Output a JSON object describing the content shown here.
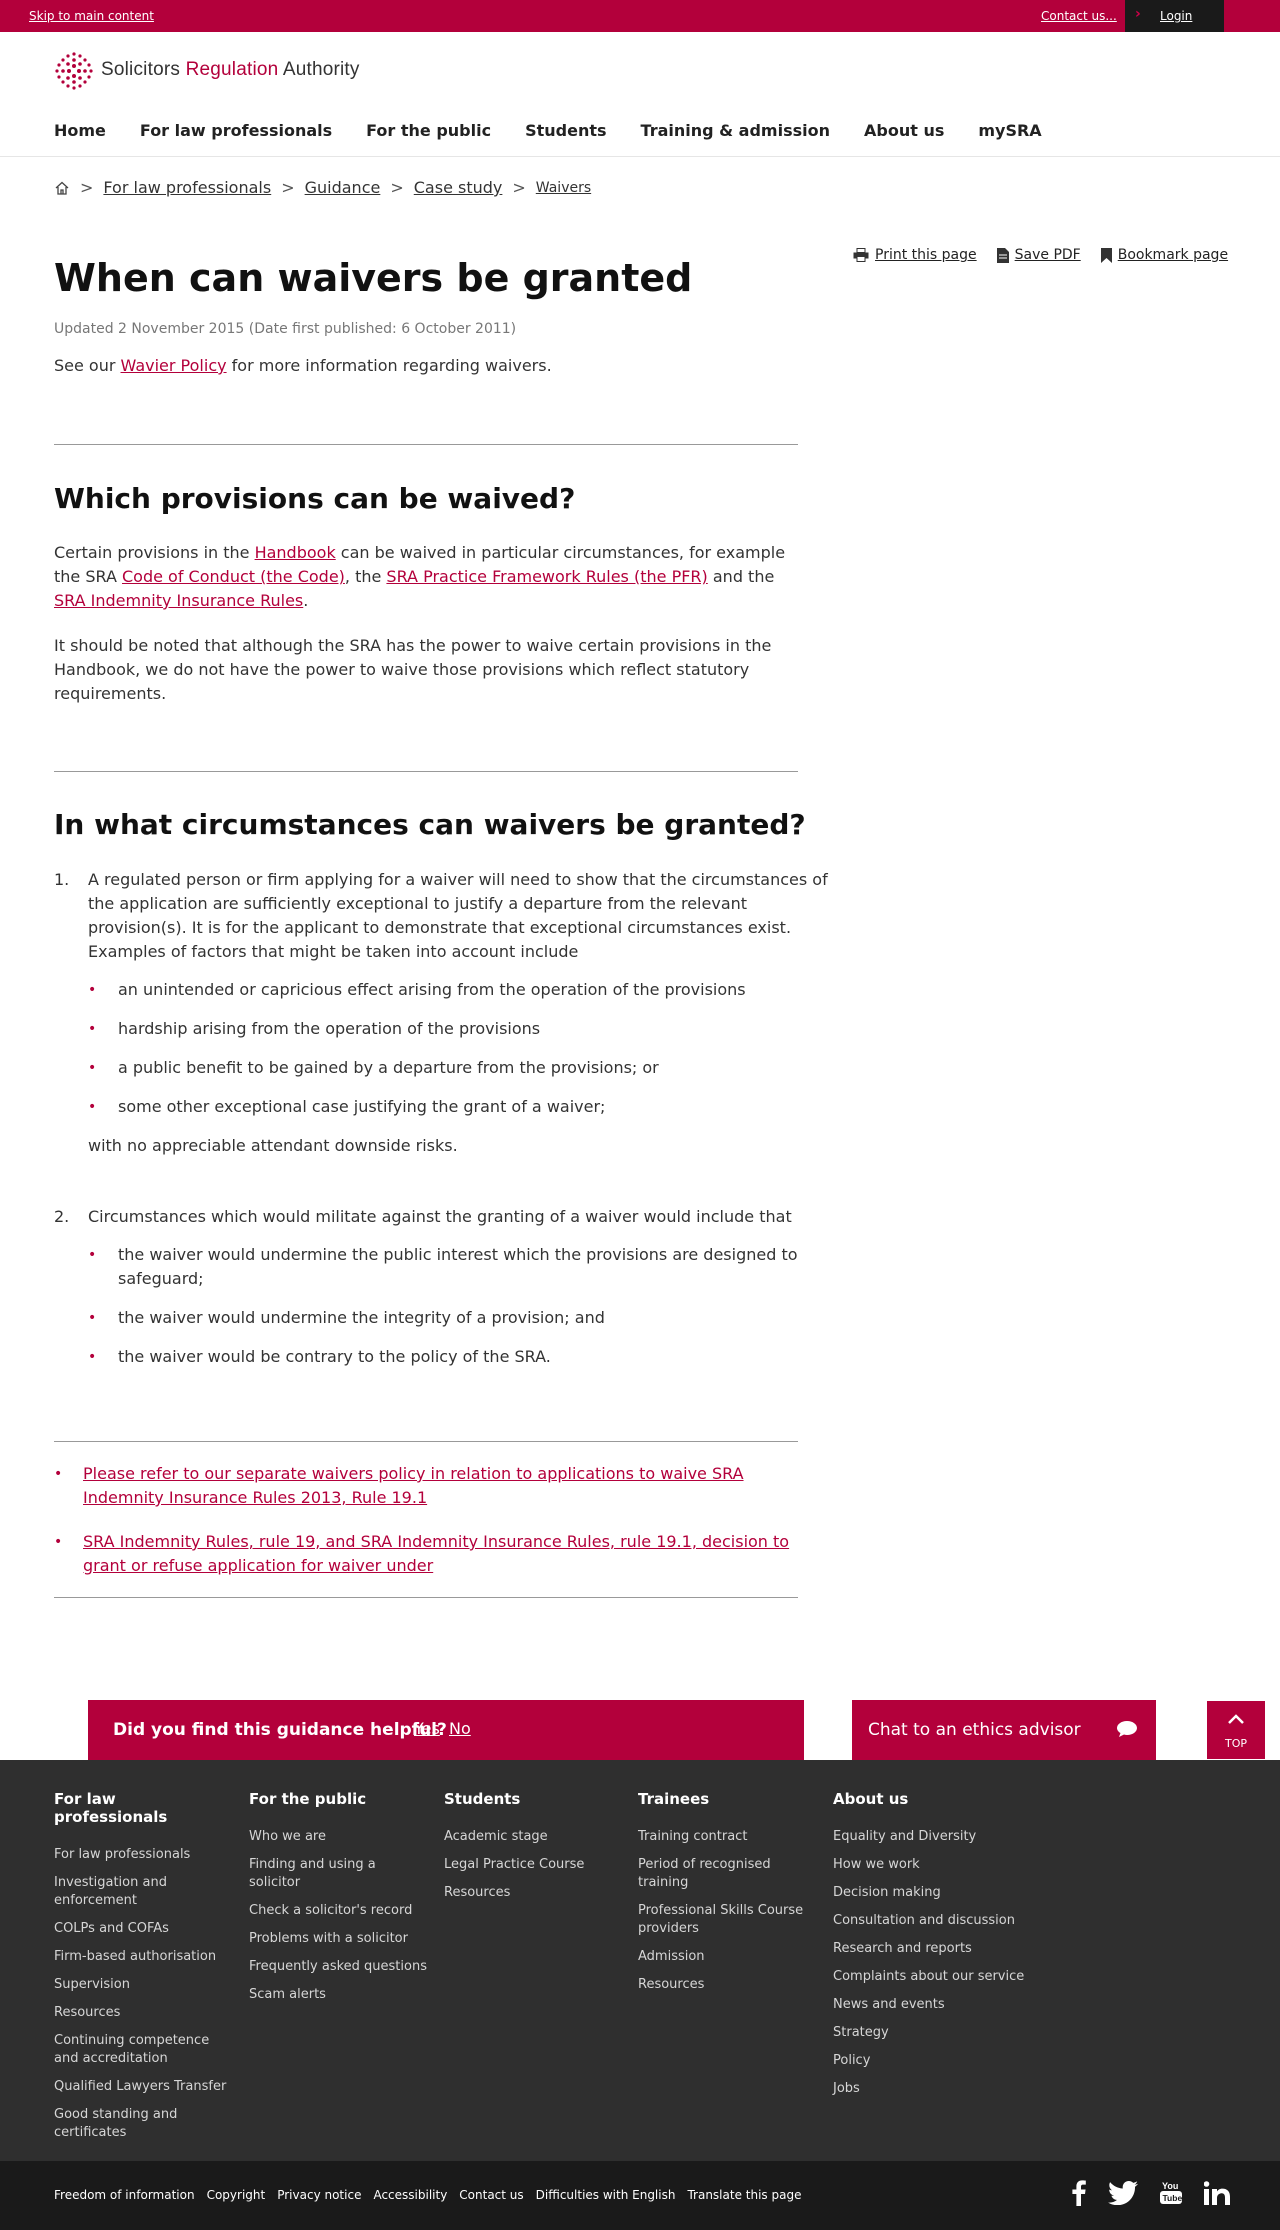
{
  "topbar": {
    "skip": "Skip to main content",
    "contact": "Contact us...",
    "login": "Login"
  },
  "logo": {
    "part1": "Solicitors ",
    "part2": "Regulation",
    "part3": " Authority"
  },
  "nav": [
    "Home",
    "For law professionals",
    "For the public",
    "Students",
    "Training & admission",
    "About us",
    "mySRA"
  ],
  "breadcrumb": {
    "sep": ">",
    "items": [
      "For law professionals",
      "Guidance",
      "Case study"
    ],
    "current": "Waivers"
  },
  "tools": {
    "print": "Print this page",
    "pdf": "Save PDF",
    "bookmark": "Bookmark page"
  },
  "page": {
    "title": "When can waivers be granted",
    "updated": "Updated 2 November 2015 (Date first published: 6 October 2011)",
    "intro_pre": "See our ",
    "intro_link": "Wavier Policy",
    "intro_post": " for more information regarding waivers."
  },
  "section1": {
    "heading": "Which provisions can be waived?",
    "p1_a": "Certain provisions in the ",
    "p1_link1": "Handbook",
    "p1_b": " can be waived in particular circumstances, for example the SRA ",
    "p1_link2": "Code of Conduct (the Code)",
    "p1_c": ", the ",
    "p1_link3": "SRA Practice Framework Rules (the PFR)",
    "p1_d": " and the ",
    "p1_link4": "SRA Indemnity Insurance Rules",
    "p1_e": ".",
    "p2": "It should be noted that although the SRA has the power to waive certain provisions in the Handbook, we do not have the power to waive those provisions which reflect statutory requirements."
  },
  "section2": {
    "heading": "In what circumstances can waivers be granted?",
    "item1": {
      "num": "1.",
      "text": "A regulated person or firm applying for a waiver will need to show that the circumstances of the application are sufficiently exceptional to justify a departure from the relevant provision(s). It is for the applicant to demonstrate that exceptional circumstances exist. Examples of factors that might be taken into account include",
      "bullets": [
        "an unintended or capricious effect arising from the operation of the provisions",
        "hardship arising from the operation of the provisions",
        "a public benefit to be gained by a departure from the provisions; or",
        "some other exceptional case justifying the grant of a waiver;"
      ],
      "tail": "with no appreciable attendant downside risks."
    },
    "item2": {
      "num": "2.",
      "text": "Circumstances which would militate against the granting of a waiver would include that",
      "bullets": [
        "the waiver would undermine the public interest which the provisions are designed to safeguard;",
        "the waiver would undermine the integrity of a provision; and",
        "the waiver would be contrary to the policy of the SRA."
      ]
    }
  },
  "related": [
    "Please refer to our separate waivers policy in relation to applications to waive SRA Indemnity Insurance Rules 2013, Rule 19.1",
    "SRA Indemnity Rules, rule 19, and SRA Indemnity Insurance Rules, rule 19.1, decision to grant or refuse application for waiver under"
  ],
  "feedback": {
    "question": "Did you find this guidance helpful?",
    "yes": "Yes",
    "no": "No"
  },
  "chat": {
    "label": "Chat to an ethics advisor"
  },
  "top": {
    "label": "TOP"
  },
  "footer": {
    "cols": [
      {
        "title": "For law professionals",
        "items": [
          "For law professionals",
          "Investigation and enforcement",
          "COLPs and COFAs",
          "Firm-based authorisation",
          "Supervision",
          "Resources",
          "Continuing competence and accreditation",
          "Qualified Lawyers Transfer",
          "Good standing and certificates"
        ]
      },
      {
        "title": "For the public",
        "items": [
          "Who we are",
          "Finding and using a solicitor",
          "Check a solicitor's record",
          "Problems with a solicitor",
          "Frequently asked questions",
          "Scam alerts"
        ]
      },
      {
        "title": "Students",
        "items": [
          "Academic stage",
          "Legal Practice Course",
          "Resources"
        ]
      },
      {
        "title": "Trainees",
        "items": [
          "Training contract",
          "Period of recognised training",
          "Professional Skills Course providers",
          "Admission",
          "Resources"
        ]
      },
      {
        "title": "About us",
        "items": [
          "Equality and Diversity",
          "How we work",
          "Decision making",
          "Consultation and discussion",
          "Research and reports",
          "Complaints about our service",
          "News and events",
          "Strategy",
          "Policy",
          "Jobs"
        ]
      }
    ],
    "bottom_links": [
      "Freedom of information",
      "Copyright",
      "Privacy notice",
      "Accessibility",
      "Contact us",
      "Difficulties with English",
      "Translate this page"
    ],
    "social": [
      "facebook-icon",
      "twitter-icon",
      "youtube-icon",
      "linkedin-icon"
    ]
  },
  "colors": {
    "brand": "#b3003b",
    "footer": "#2f2f2f",
    "subfooter": "#1a1a1a"
  }
}
